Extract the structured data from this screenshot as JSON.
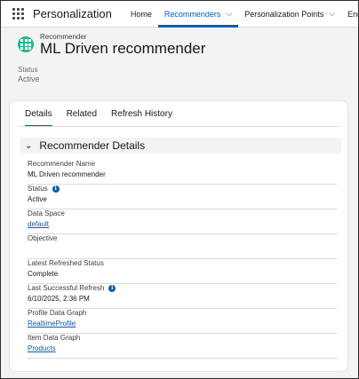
{
  "nav": {
    "app_name": "Personalization",
    "items": [
      {
        "label": "Home"
      },
      {
        "label": "Recommenders"
      },
      {
        "label": "Personalization Points"
      },
      {
        "label": "Engagemen"
      }
    ]
  },
  "header": {
    "entity_type": "Recommender",
    "title": "ML Driven recommender",
    "status_label": "Status",
    "status_value": "Active"
  },
  "tabs": [
    {
      "label": "Details"
    },
    {
      "label": "Related"
    },
    {
      "label": "Refresh History"
    }
  ],
  "section": {
    "title": "Recommender Details"
  },
  "fields": [
    {
      "label": "Recommender Name",
      "value": "ML Driven recommender"
    },
    {
      "label": "Status",
      "value": "Active"
    },
    {
      "label": "Data Space",
      "value": "default"
    },
    {
      "label": "Objective",
      "value": ""
    },
    {
      "label": "Latest Refreshed Status",
      "value": "Complete"
    },
    {
      "label": "Last Successful Refresh",
      "value": "6/10/2025, 2:36 PM"
    },
    {
      "label": "Profile Data Graph",
      "value": "RealtimeProfile"
    },
    {
      "label": "Item Data Graph",
      "value": "Products"
    }
  ],
  "colors": {
    "brand_blue": "#0b5cab",
    "recommender_icon": "#2cb392"
  },
  "icons": {
    "app_launcher": "waffle-icon",
    "recommender": "recommender-icon",
    "info": "info-icon",
    "chevron": "chevron-down-icon"
  }
}
